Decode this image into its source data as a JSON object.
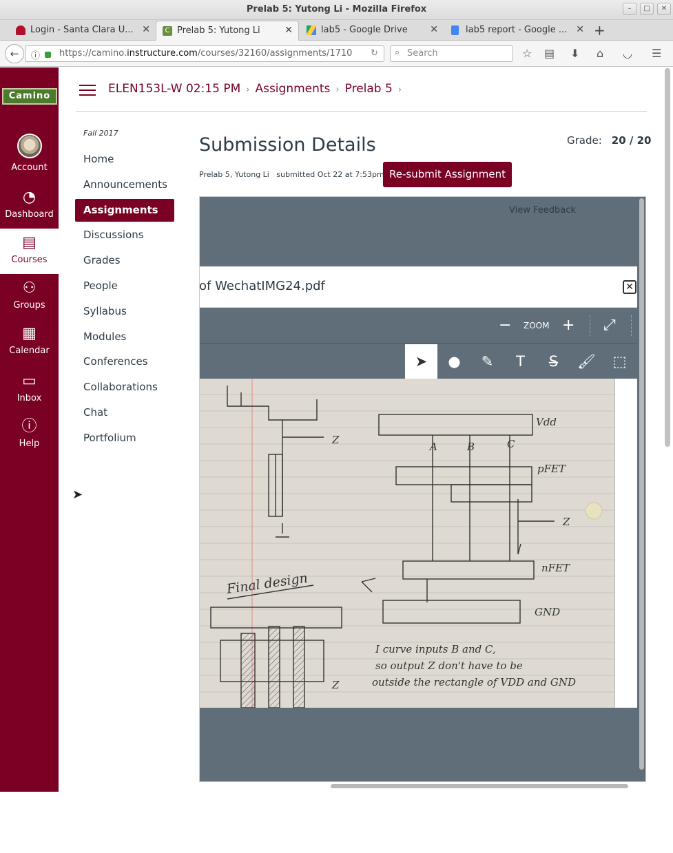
{
  "window": {
    "title": "Prelab 5: Yutong Li - Mozilla Firefox"
  },
  "tabs": [
    {
      "label": "Login - Santa Clara U...",
      "icon": "red-flame-icon"
    },
    {
      "label": "Prelab 5: Yutong Li",
      "icon": "canvas-c-icon"
    },
    {
      "label": "lab5 - Google Drive",
      "icon": "google-drive-icon"
    },
    {
      "label": "lab5 report - Google ...",
      "icon": "google-docs-icon"
    }
  ],
  "navbar": {
    "url_prefix": "https://camino.",
    "url_domain": "instructure.com",
    "url_rest": "/courses/32160/assignments/1710",
    "search_placeholder": "Search"
  },
  "global_nav": {
    "logo": "Camino",
    "items": [
      {
        "label": "Account",
        "icon": "avatar-icon"
      },
      {
        "label": "Dashboard",
        "icon": "dashboard-icon"
      },
      {
        "label": "Courses",
        "icon": "courses-icon"
      },
      {
        "label": "Groups",
        "icon": "groups-icon"
      },
      {
        "label": "Calendar",
        "icon": "calendar-icon"
      },
      {
        "label": "Inbox",
        "icon": "inbox-icon"
      },
      {
        "label": "Help",
        "icon": "help-icon"
      }
    ]
  },
  "breadcrumb": {
    "course": "ELEN153L-W 02:15 PM",
    "section": "Assignments",
    "item": "Prelab 5"
  },
  "course_nav": {
    "term": "Fall 2017",
    "items": [
      "Home",
      "Announcements",
      "Assignments",
      "Discussions",
      "Grades",
      "People",
      "Syllabus",
      "Modules",
      "Conferences",
      "Collaborations",
      "Chat",
      "Portfolium"
    ],
    "active": "Assignments"
  },
  "main": {
    "title": "Submission Details",
    "grade_label": "Grade:",
    "grade_value": "20 / 20",
    "assignment_meta": "Prelab 5, Yutong Li",
    "submitted_meta": "submitted Oct 22 at 7:53pm",
    "resubmit_label": "Re-submit Assignment",
    "view_feedback": "View Feedback"
  },
  "doc_viewer": {
    "filename": "of WechatIMG24.pdf",
    "zoom_label": "ZOOM",
    "tools": [
      "pointer-icon",
      "point-annotation-icon",
      "highlight-icon",
      "text-icon",
      "strikeout-icon",
      "freedraw-icon",
      "area-select-icon"
    ],
    "page_text": {
      "vdd": "Vdd",
      "pfet": "pFET",
      "nfet": "nFET",
      "gnd": "GND",
      "z": "Z",
      "final_design": "Final design",
      "note1": "I curve inputs B and C,",
      "note2": "so output Z don't have to be",
      "note3": "outside the rectangle of VDD and GND",
      "a": "A",
      "b": "B",
      "c": "C"
    }
  }
}
